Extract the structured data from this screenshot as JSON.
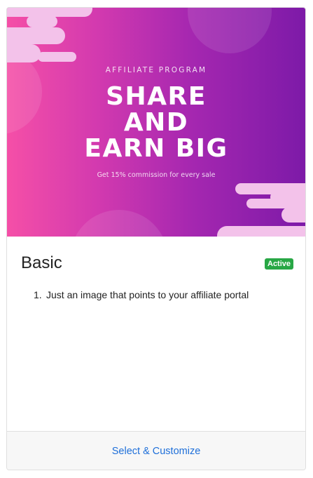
{
  "banner": {
    "eyebrow": "AFFILIATE PROGRAM",
    "headline_line1": "SHARE",
    "headline_line2": "AND",
    "headline_line3": "EARN BIG",
    "subline": "Get 15% commission for every sale",
    "colors": {
      "gradient_start": "#f54fa7",
      "gradient_end": "#7d1aa8",
      "pill": "#f3c2ea"
    }
  },
  "card": {
    "title": "Basic",
    "status_badge": "Active",
    "status_color": "#28a745",
    "features": [
      {
        "number": "1.",
        "text": "Just an image that points to your affiliate portal"
      }
    ],
    "footer_link": "Select & Customize",
    "link_color": "#1e6fd9"
  }
}
